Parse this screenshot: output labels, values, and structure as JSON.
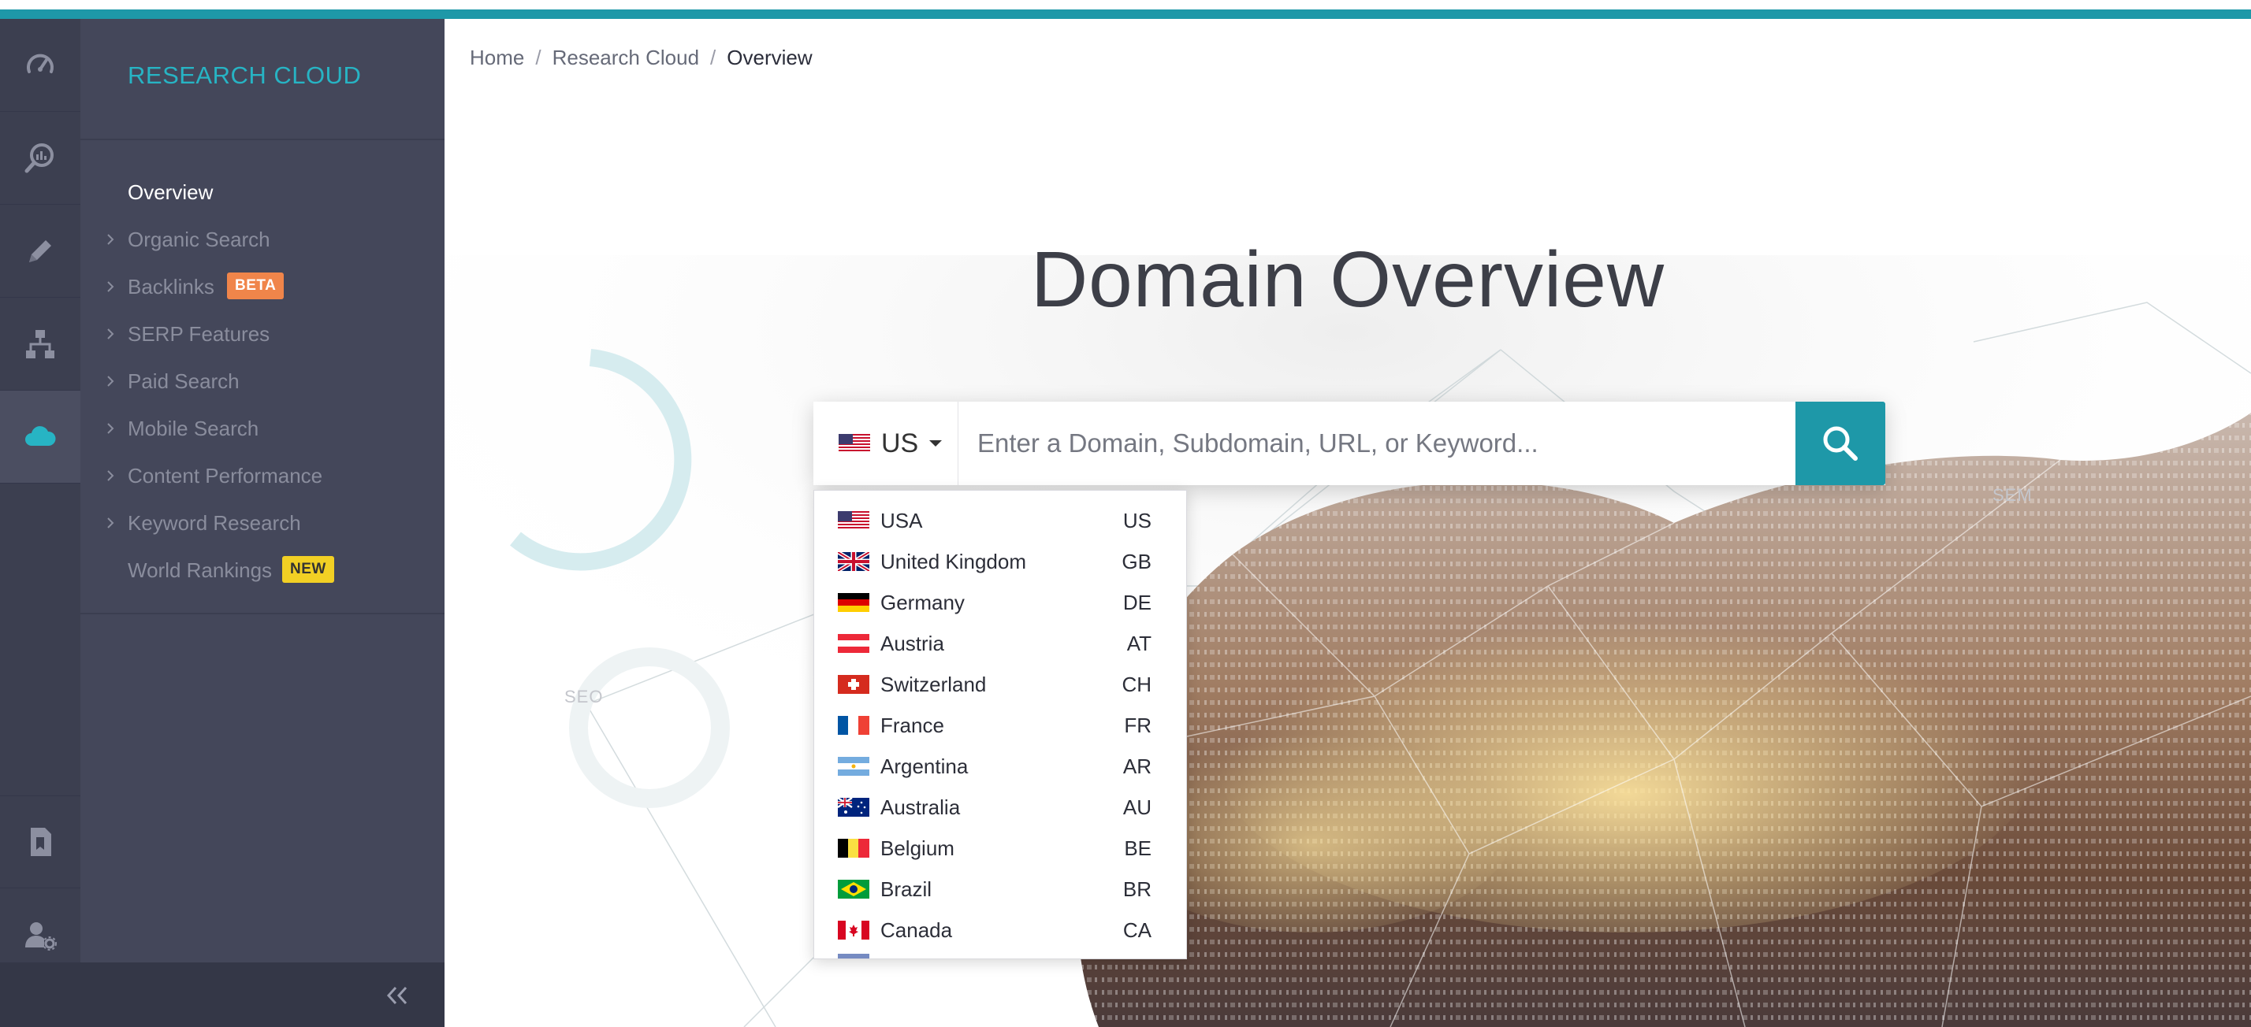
{
  "app": {
    "title": "RESEARCH CLOUD"
  },
  "rail": {
    "items": [
      {
        "icon": "dashboard-gauge-icon"
      },
      {
        "icon": "analytics-search-icon"
      },
      {
        "icon": "pencil-icon"
      },
      {
        "icon": "site-structure-icon"
      },
      {
        "icon": "cloud-icon",
        "active": true
      },
      {
        "icon": "bookmark-report-icon"
      },
      {
        "icon": "user-settings-icon"
      }
    ]
  },
  "sidebar": {
    "items": [
      {
        "label": "Overview",
        "current": true,
        "expandable": false
      },
      {
        "label": "Organic Search",
        "expandable": true
      },
      {
        "label": "Backlinks",
        "expandable": true,
        "badge": "BETA"
      },
      {
        "label": "SERP Features",
        "expandable": true
      },
      {
        "label": "Paid Search",
        "expandable": true
      },
      {
        "label": "Mobile Search",
        "expandable": true
      },
      {
        "label": "Content Performance",
        "expandable": true
      },
      {
        "label": "Keyword Research",
        "expandable": true
      },
      {
        "label": "World Rankings",
        "expandable": false,
        "badge": "NEW"
      }
    ],
    "collapse_icon": "double-chevron-left-icon"
  },
  "breadcrumb": {
    "home": "Home",
    "section": "Research Cloud",
    "current": "Overview",
    "separator": "/"
  },
  "main": {
    "title": "Domain Overview",
    "search": {
      "country_code": "US",
      "placeholder": "Enter a Domain, Subdomain, URL, or Keyword...",
      "value": ""
    },
    "decor_labels": {
      "sem": "SEM",
      "seo": "SEO"
    }
  },
  "dropdown": {
    "countries": [
      {
        "name": "USA",
        "code": "US"
      },
      {
        "name": "United Kingdom",
        "code": "GB"
      },
      {
        "name": "Germany",
        "code": "DE"
      },
      {
        "name": "Austria",
        "code": "AT"
      },
      {
        "name": "Switzerland",
        "code": "CH"
      },
      {
        "name": "France",
        "code": "FR"
      },
      {
        "name": "Argentina",
        "code": "AR"
      },
      {
        "name": "Australia",
        "code": "AU"
      },
      {
        "name": "Belgium",
        "code": "BE"
      },
      {
        "name": "Brazil",
        "code": "BR"
      },
      {
        "name": "Canada",
        "code": "CA"
      }
    ]
  },
  "colors": {
    "accent": "#1e98a8",
    "title_accent": "#27b4c4",
    "sidebar_bg": "#44475a",
    "rail_bg": "#3c3f50",
    "beta_badge": "#f0854a",
    "new_badge": "#f2d024"
  }
}
